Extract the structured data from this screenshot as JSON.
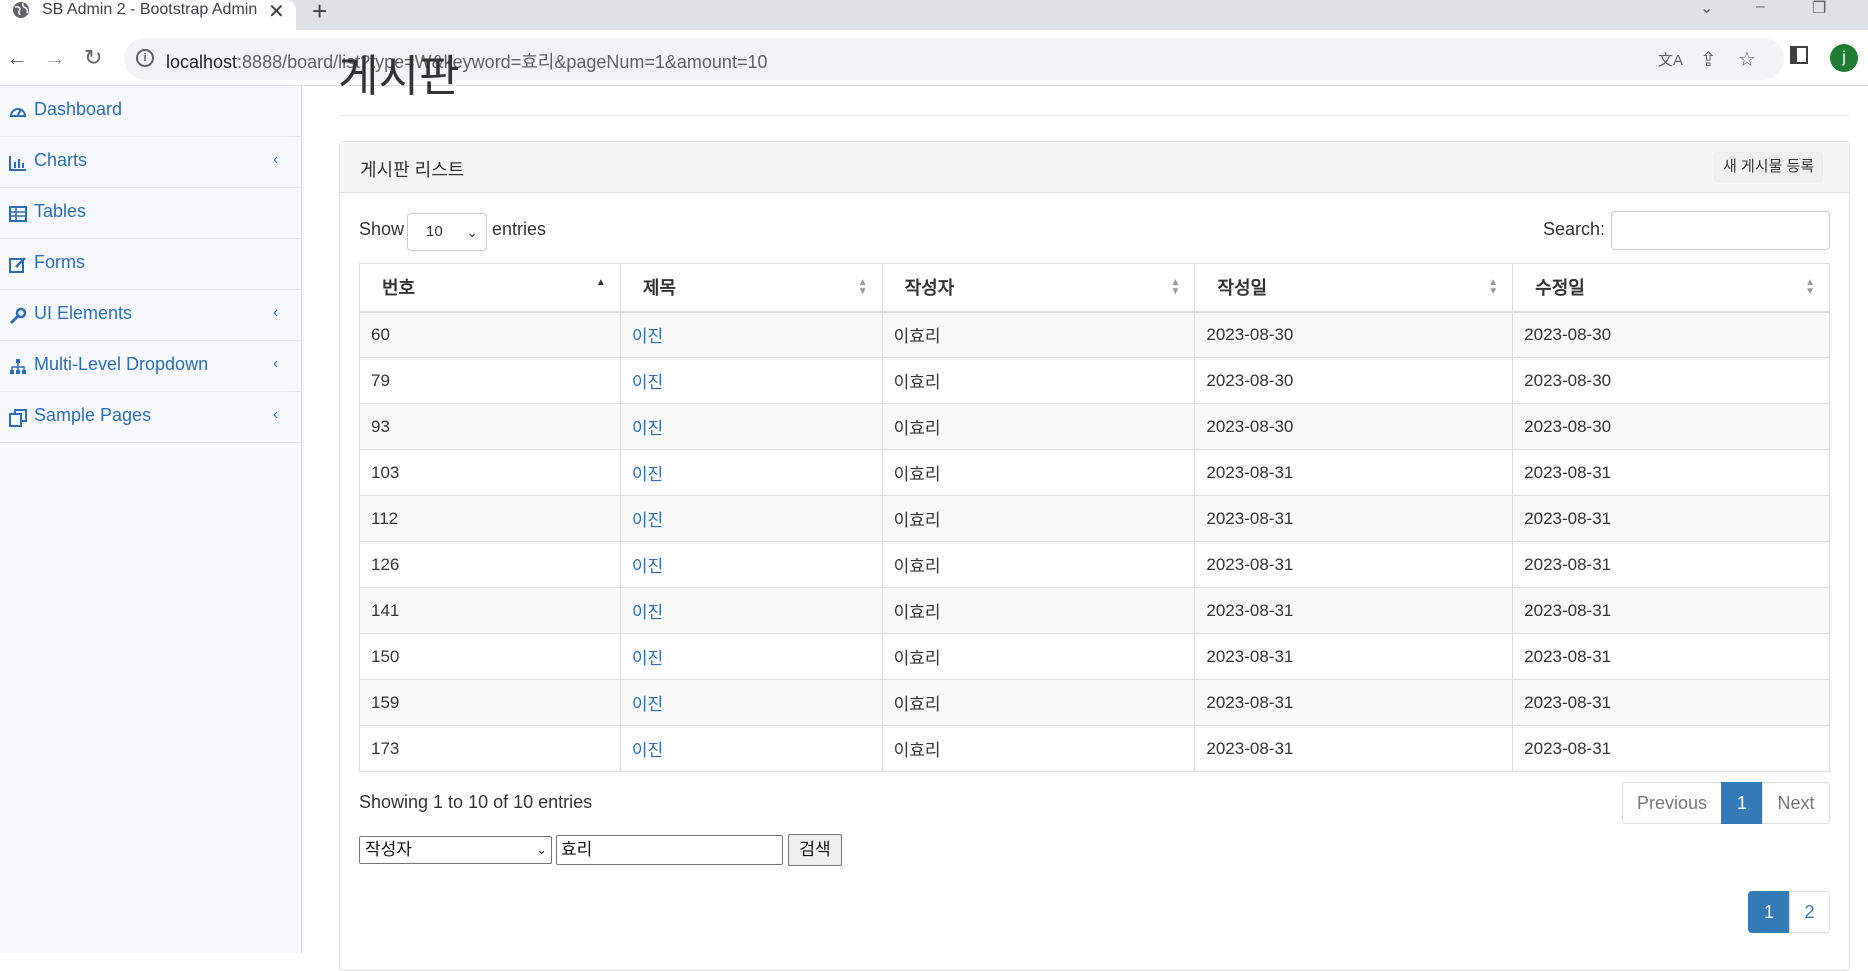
{
  "browser": {
    "tab_title": "SB Admin 2 - Bootstrap Admin",
    "url_host": "localhost",
    "url_rest": ":8888/board/list?type=W&keyword=효리&pageNum=1&amount=10",
    "avatar_letter": "j",
    "icons": [
      "globe-icon",
      "close-icon",
      "new-tab-icon",
      "back-icon",
      "forward-icon",
      "reload-icon",
      "info-icon",
      "translate-icon",
      "share-icon",
      "star-icon",
      "side-panel-icon"
    ]
  },
  "sidebar": {
    "items": [
      {
        "label": "Dashboard",
        "icon": "dashboard-icon",
        "has_chevron": false
      },
      {
        "label": "Charts",
        "icon": "bar-chart-icon",
        "has_chevron": true
      },
      {
        "label": "Tables",
        "icon": "table-icon",
        "has_chevron": false
      },
      {
        "label": "Forms",
        "icon": "edit-icon",
        "has_chevron": false
      },
      {
        "label": "UI Elements",
        "icon": "wrench-icon",
        "has_chevron": true
      },
      {
        "label": "Multi-Level Dropdown",
        "icon": "sitemap-icon",
        "has_chevron": true
      },
      {
        "label": "Sample Pages",
        "icon": "copy-icon",
        "has_chevron": true
      }
    ],
    "chevron": "‹"
  },
  "page": {
    "title": "게시판"
  },
  "panel": {
    "title": "게시판 리스트",
    "new_post_label": "새 게시물 등록",
    "show_label": "Show",
    "entries_label": "entries",
    "length_value": "10",
    "search_label": "Search:",
    "search_value": ""
  },
  "table": {
    "columns": [
      "번호",
      "제목",
      "작성자",
      "작성일",
      "수정일"
    ],
    "rows": [
      [
        "60",
        "이진",
        "이효리",
        "2023-08-30",
        "2023-08-30"
      ],
      [
        "79",
        "이진",
        "이효리",
        "2023-08-30",
        "2023-08-30"
      ],
      [
        "93",
        "이진",
        "이효리",
        "2023-08-30",
        "2023-08-30"
      ],
      [
        "103",
        "이진",
        "이효리",
        "2023-08-31",
        "2023-08-31"
      ],
      [
        "112",
        "이진",
        "이효리",
        "2023-08-31",
        "2023-08-31"
      ],
      [
        "126",
        "이진",
        "이효리",
        "2023-08-31",
        "2023-08-31"
      ],
      [
        "141",
        "이진",
        "이효리",
        "2023-08-31",
        "2023-08-31"
      ],
      [
        "150",
        "이진",
        "이효리",
        "2023-08-31",
        "2023-08-31"
      ],
      [
        "159",
        "이진",
        "이효리",
        "2023-08-31",
        "2023-08-31"
      ],
      [
        "173",
        "이진",
        "이효리",
        "2023-08-31",
        "2023-08-31"
      ]
    ]
  },
  "footer": {
    "info": "Showing 1 to 10 of 10 entries",
    "prev_label": "Previous",
    "current_page": "1",
    "next_label": "Next"
  },
  "search_form": {
    "type_value": "작성자",
    "keyword_value": "효리",
    "submit_label": "검색"
  },
  "bottom_pager": {
    "pages": [
      "1",
      "2"
    ],
    "active": "1"
  },
  "colors": {
    "link": "#2a6ebb",
    "primary": "#337ab7",
    "avatar": "#1e7d32"
  }
}
